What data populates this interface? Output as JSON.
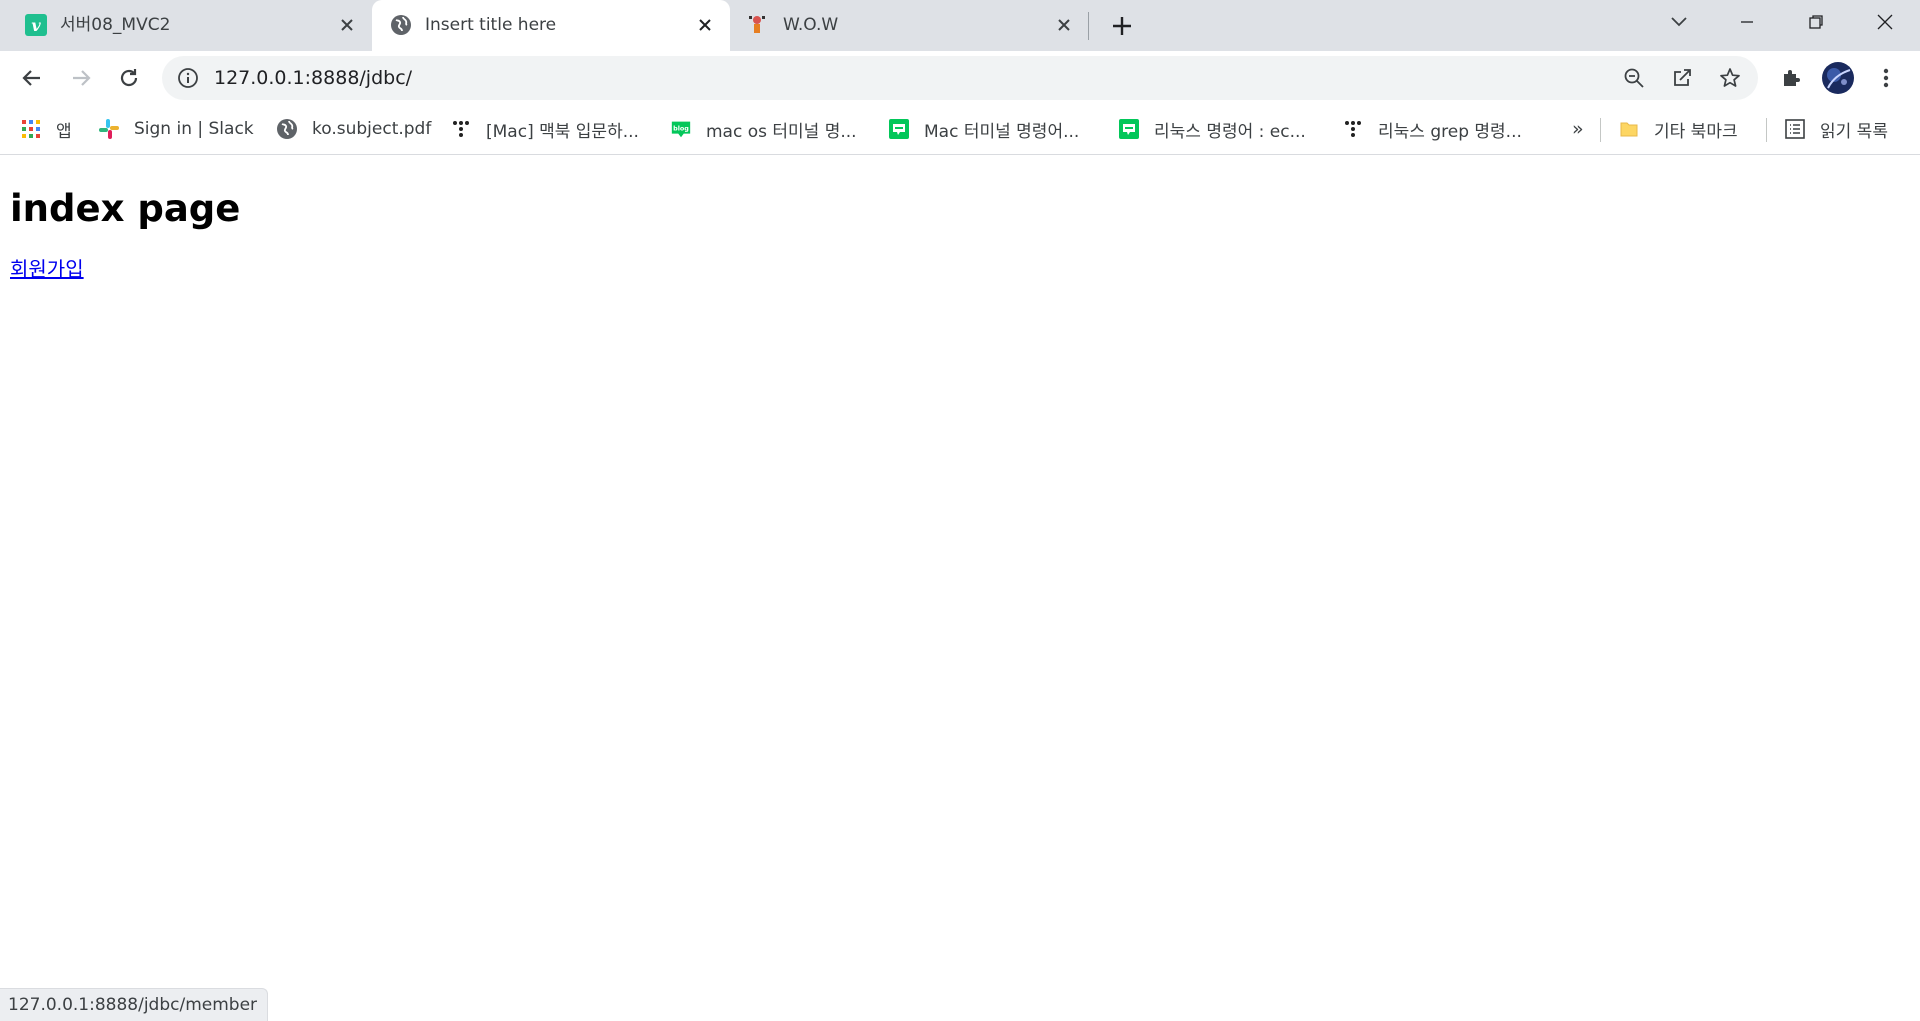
{
  "tabs": [
    {
      "title": "서버08_MVC2",
      "icon": "vimeo-v-icon",
      "active": false
    },
    {
      "title": "Insert title here",
      "icon": "globe-icon",
      "active": true
    },
    {
      "title": "W.O.W",
      "icon": "character-icon",
      "active": false
    }
  ],
  "address_bar": {
    "url": "127.0.0.1:8888/jdbc/"
  },
  "bookmarks": [
    {
      "label": "앱",
      "icon": "apps-grid-icon"
    },
    {
      "label": "Sign in | Slack",
      "icon": "slack-icon"
    },
    {
      "label": "ko.subject.pdf",
      "icon": "globe-icon"
    },
    {
      "label": "[Mac] 맥북 입문하...",
      "icon": "tistory-icon"
    },
    {
      "label": "mac os 터미널 명...",
      "icon": "naver-blog-icon"
    },
    {
      "label": "Mac 터미널 명령어...",
      "icon": "naver-blog-icon"
    },
    {
      "label": "리눅스 명령어 : ec...",
      "icon": "naver-blog-icon"
    },
    {
      "label": "리눅스 grep 명령...",
      "icon": "tistory-icon"
    }
  ],
  "bookmarks_overflow": "»",
  "other_bookmarks": "기타 북마크",
  "reading_list": "읽기 목록",
  "page": {
    "heading": "index page",
    "link_text": "회원가입"
  },
  "status_bar": "127.0.0.1:8888/jdbc/member",
  "colors": {
    "tabstrip": "#dee1e6",
    "link": "#0000ee",
    "naver_green": "#03c75a",
    "vimeo_teal": "#1ab7ea"
  }
}
